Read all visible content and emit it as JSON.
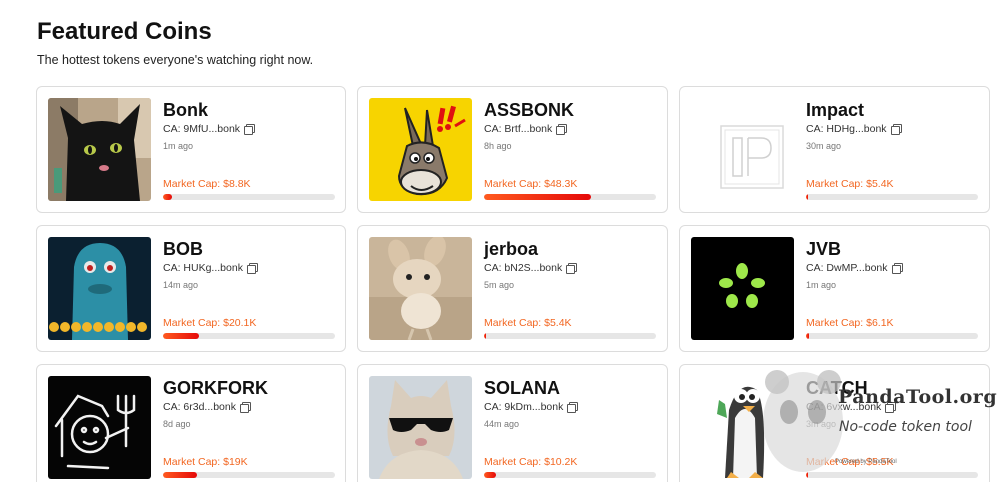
{
  "header": {
    "title": "Featured Coins",
    "subtitle": "The hottest tokens everyone's watching right now."
  },
  "colors": {
    "accent": "#f26722",
    "bar_fill": "#e50909",
    "bar_track": "#e6e6e6"
  },
  "coins": [
    {
      "name": "Bonk",
      "ca": "CA: 9MfU...bonk",
      "age": "1m ago",
      "market_cap": "Market Cap: $8.8K",
      "progress": 0.05,
      "image": "black-cat"
    },
    {
      "name": "ASSBONK",
      "ca": "CA: Brtf...bonk",
      "age": "8h ago",
      "market_cap": "Market Cap: $48.3K",
      "progress": 0.62,
      "image": "donkey-cartoon"
    },
    {
      "name": "Impact",
      "ca": "CA: HDHg...bonk",
      "age": "30m ago",
      "market_cap": "Market Cap: $5.4K",
      "progress": 0.01,
      "image": "ip-logo"
    },
    {
      "name": "BOB",
      "ca": "CA: HUKg...bonk",
      "age": "14m ago",
      "market_cap": "Market Cap: $20.1K",
      "progress": 0.21,
      "image": "blue-blob"
    },
    {
      "name": "jerboa",
      "ca": "CA: bN2S...bonk",
      "age": "5m ago",
      "market_cap": "Market Cap: $5.4K",
      "progress": 0.01,
      "image": "jerboa"
    },
    {
      "name": "JVB",
      "ca": "CA: DwMP...bonk",
      "age": "1m ago",
      "market_cap": "Market Cap: $6.1K",
      "progress": 0.02,
      "image": "green-dots"
    },
    {
      "name": "GORKFORK",
      "ca": "CA: 6r3d...bonk",
      "age": "8d ago",
      "market_cap": "Market Cap: $19K",
      "progress": 0.2,
      "image": "chalk-drawing"
    },
    {
      "name": "SOLANA",
      "ca": "CA: 9kDm...bonk",
      "age": "44m ago",
      "market_cap": "Market Cap: $10.2K",
      "progress": 0.07,
      "image": "cat-sunglasses"
    },
    {
      "name": "CATCH",
      "ca": "CA: 6vxw...bonk",
      "age": "3m ago",
      "market_cap": "Market Cap: $5.5K",
      "progress": 0.01,
      "image": "penguin-meme"
    }
  ],
  "watermark": {
    "brand": "PandaTool.org",
    "tagline": "No-code token tool",
    "powered": "Powered by PandaTool"
  }
}
